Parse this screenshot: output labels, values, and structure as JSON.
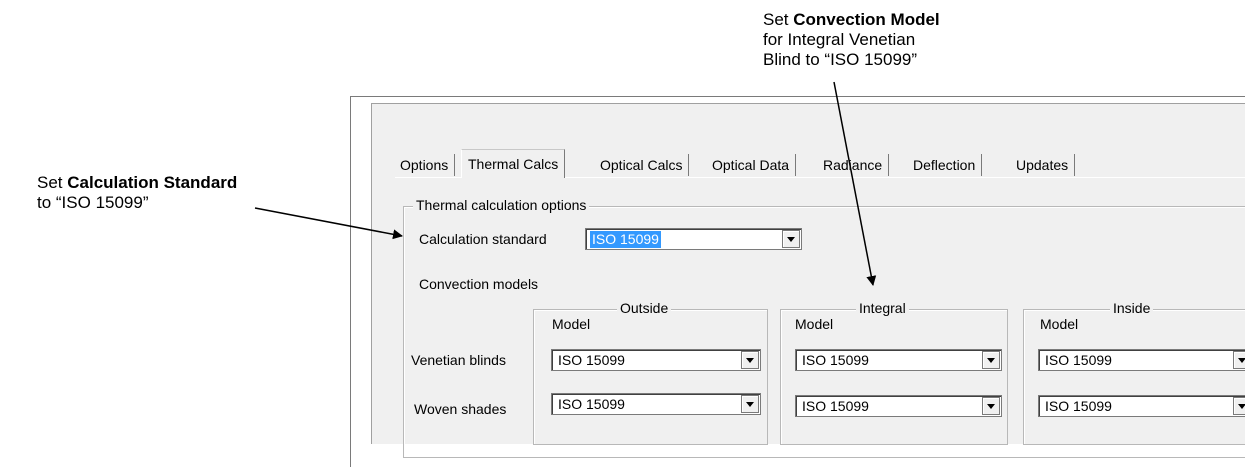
{
  "annotations": {
    "calc_standard": {
      "prefix": "Set ",
      "bold": "Calculation Standard",
      "suffix": "to “ISO 15099”"
    },
    "convection": {
      "prefix": "Set ",
      "bold": "Convection Model",
      "line2": "for Integral Venetian",
      "line3": "Blind to “ISO 15099”"
    }
  },
  "tabs": [
    "Options",
    "Thermal Calcs",
    "Optical Calcs",
    "Optical Data",
    "Radiance",
    "Deflection",
    "Updates"
  ],
  "active_tab": "Thermal Calcs",
  "thermal": {
    "group_title": "Thermal calculation options",
    "calc_standard_label": "Calculation standard",
    "calc_standard_value": "ISO 15099",
    "convection_label": "Convection models",
    "columns": [
      {
        "title": "Outside",
        "model_label": "Model",
        "venetian": "ISO 15099",
        "woven": "ISO 15099"
      },
      {
        "title": "Integral",
        "model_label": "Model",
        "venetian": "ISO 15099",
        "woven": "ISO 15099"
      },
      {
        "title": "Inside",
        "model_label": "Model",
        "venetian": "ISO 15099",
        "woven": "ISO 15099"
      }
    ],
    "row_labels": {
      "venetian": "Venetian blinds",
      "woven": "Woven shades"
    }
  }
}
